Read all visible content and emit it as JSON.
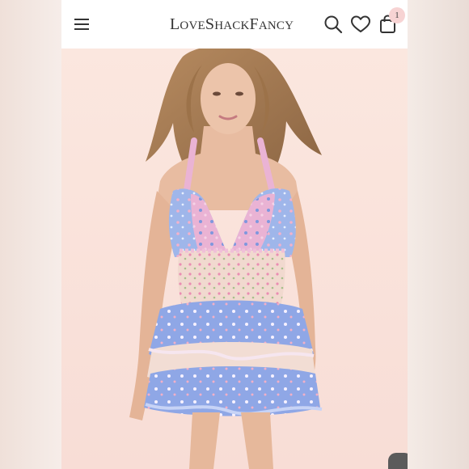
{
  "header": {
    "menu_icon": "hamburger-menu-icon",
    "logo_parts": [
      {
        "big": "L",
        "small": "OVE"
      },
      {
        "big": "S",
        "small": "HACK"
      },
      {
        "big": "F",
        "small": "ANCY"
      }
    ],
    "actions": {
      "search_icon": "search-icon",
      "wishlist_icon": "heart-icon",
      "cart_icon": "shopping-bag-icon",
      "cart_count": "1"
    }
  },
  "hero": {
    "image": "model wearing halter mini dress with floral tiered ruffle skirt",
    "colors": {
      "background": "#fbe9e2",
      "bodice_pink": "#eab3d4",
      "bodice_blue": "#9fb6ea",
      "waist_cream": "#f1d9cf",
      "tier_blue": "#8fa7e6",
      "tier_cream": "#f2ddd4",
      "hair": "#a57a52",
      "skin": "#e8bca1"
    }
  }
}
